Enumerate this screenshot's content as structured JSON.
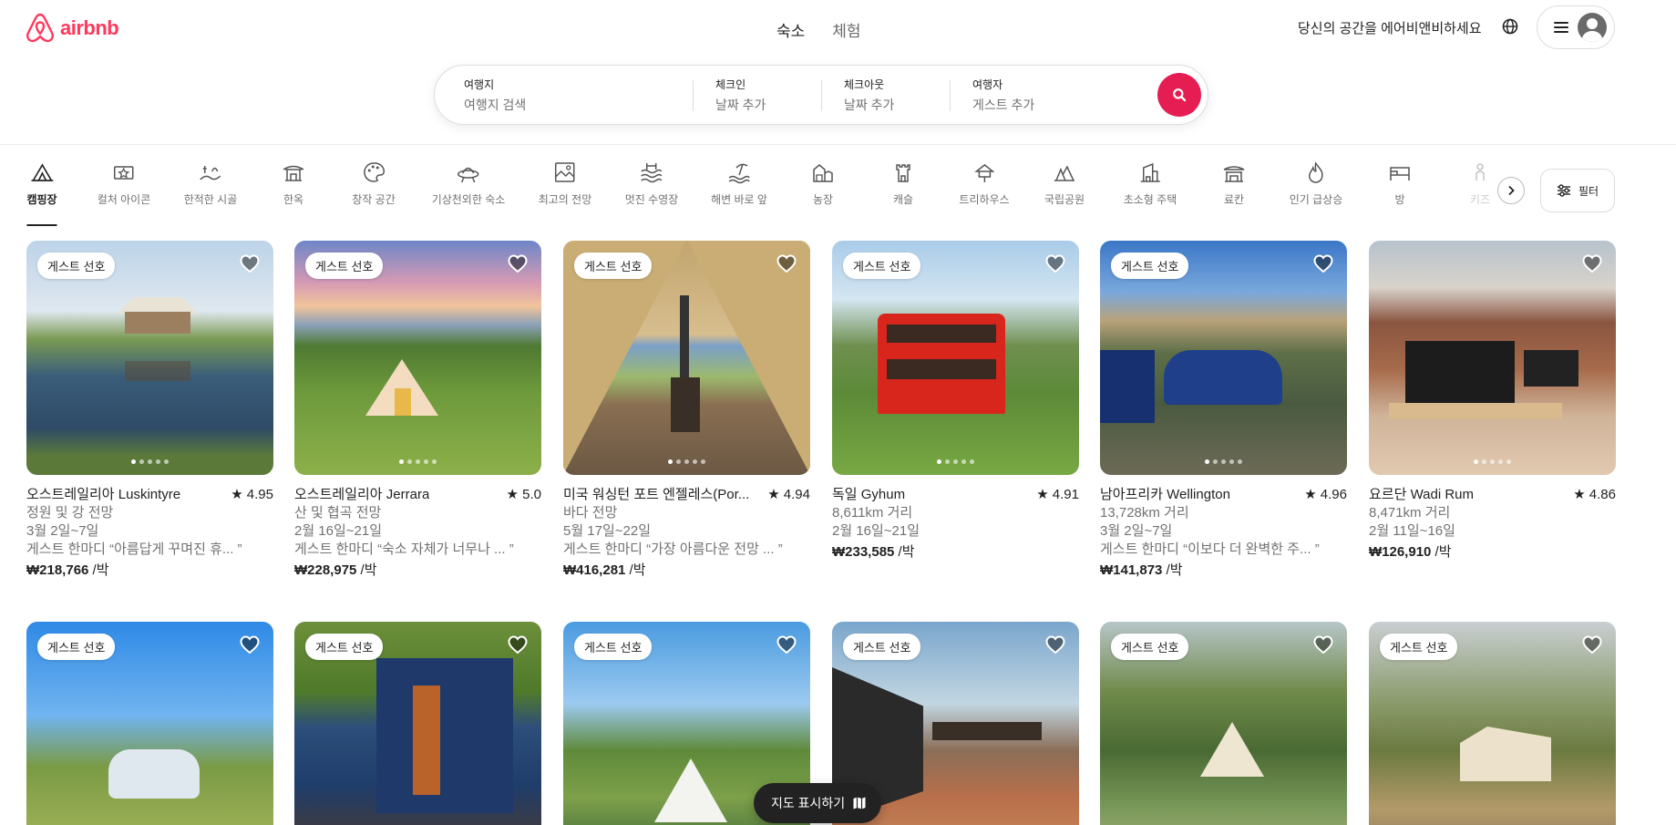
{
  "header": {
    "logo_text": "airbnb",
    "nav": {
      "stays": "숙소",
      "experiences": "체험"
    },
    "host_link": "당신의 공간을 에어비앤비하세요",
    "brand_color": "#ff385c"
  },
  "search": {
    "where": {
      "label": "여행지",
      "placeholder": "여행지 검색"
    },
    "checkin": {
      "label": "체크인",
      "placeholder": "날짜 추가"
    },
    "checkout": {
      "label": "체크아웃",
      "placeholder": "날짜 추가"
    },
    "guests": {
      "label": "여행자",
      "placeholder": "게스트 추가"
    },
    "button_color": "#e51d53"
  },
  "categories": [
    {
      "label": "캠핑장",
      "icon": "camping-icon",
      "active": true
    },
    {
      "label": "컬처 아이콘",
      "icon": "culture-icon"
    },
    {
      "label": "한적한 시골",
      "icon": "countryside-icon"
    },
    {
      "label": "한옥",
      "icon": "hanok-icon"
    },
    {
      "label": "창작 공간",
      "icon": "creative-space-icon"
    },
    {
      "label": "기상천외한 숙소",
      "icon": "omg-icon"
    },
    {
      "label": "최고의 전망",
      "icon": "amazing-views-icon"
    },
    {
      "label": "멋진 수영장",
      "icon": "pool-icon"
    },
    {
      "label": "해변 바로 앞",
      "icon": "beachfront-icon"
    },
    {
      "label": "농장",
      "icon": "farm-icon"
    },
    {
      "label": "캐슬",
      "icon": "castle-icon"
    },
    {
      "label": "트리하우스",
      "icon": "treehouse-icon"
    },
    {
      "label": "국립공원",
      "icon": "national-park-icon"
    },
    {
      "label": "초소형 주택",
      "icon": "tiny-home-icon"
    },
    {
      "label": "료칸",
      "icon": "ryokan-icon"
    },
    {
      "label": "인기 급상승",
      "icon": "trending-icon"
    },
    {
      "label": "방",
      "icon": "rooms-icon"
    },
    {
      "label": "키즈",
      "icon": "kids-icon"
    }
  ],
  "filter_label": "필터",
  "listings": [
    {
      "badge": "게스트 선호",
      "title": "오스트레일리아 Luskintyre",
      "rating": "★ 4.95",
      "line2": "정원 및 강 전망",
      "dates": "3월 2일~7일",
      "review": "게스트 한마디 “아름답게 꾸며진 휴...  ”",
      "price": "₩218,766",
      "per": " /박"
    },
    {
      "badge": "게스트 선호",
      "title": "오스트레일리아 Jerrara",
      "rating": "★ 5.0",
      "line2": "산 및 협곡 전망",
      "dates": "2월 16일~21일",
      "review": "게스트 한마디 “숙소 자체가 너무나 ...  ”",
      "price": "₩228,975",
      "per": " /박"
    },
    {
      "badge": "게스트 선호",
      "title": "미국 워싱턴 포트 엔젤레스(Por...",
      "rating": "★ 4.94",
      "line2": "바다 전망",
      "dates": "5월 17일~22일",
      "review": "게스트 한마디 “가장 아름다운 전망 ...  ”",
      "price": "₩416,281",
      "per": " /박"
    },
    {
      "badge": "게스트 선호",
      "title": "독일 Gyhum",
      "rating": "★ 4.91",
      "line2": "8,611km 거리",
      "dates": "2월 16일~21일",
      "review": "",
      "price": "₩233,585",
      "per": " /박"
    },
    {
      "badge": "게스트 선호",
      "title": "남아프리카 Wellington",
      "rating": "★ 4.96",
      "line2": "13,728km 거리",
      "dates": "3월 2일~7일",
      "review": "게스트 한마디 “이보다 더 완벽한 주...  ”",
      "price": "₩141,873",
      "per": " /박"
    },
    {
      "badge": "",
      "title": "요르단 Wadi Rum",
      "rating": "★ 4.86",
      "line2": "8,471km 거리",
      "dates": "2월 11일~16일",
      "review": "",
      "price": "₩126,910",
      "per": " /박"
    },
    {
      "badge": "게스트 선호"
    },
    {
      "badge": "게스트 선호"
    },
    {
      "badge": "게스트 선호"
    },
    {
      "badge": "게스트 선호"
    },
    {
      "badge": "게스트 선호"
    },
    {
      "badge": "게스트 선호"
    }
  ],
  "map_button": "지도 표시하기"
}
